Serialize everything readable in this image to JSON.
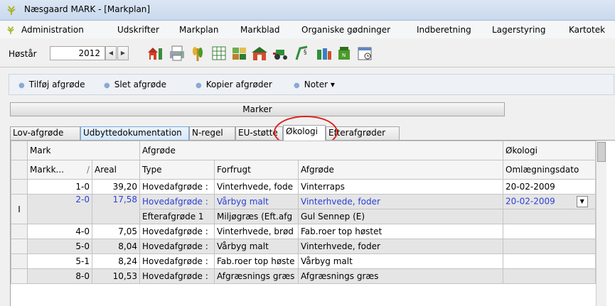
{
  "window": {
    "title": "Næsgaard MARK - [Markplan]"
  },
  "menu": [
    "Administration",
    "Udskrifter",
    "Markplan",
    "Markblad",
    "Organiske gødninger",
    "Indberetning",
    "Lagerstyring",
    "Kartotek"
  ],
  "toolbar": {
    "year_label": "Høstår",
    "year_value": "2012",
    "icons": [
      "farm-icon",
      "printer-icon",
      "crops-icon",
      "spreadsheet-icon",
      "fields-icon",
      "barn-icon",
      "tractor-icon",
      "law-icon",
      "bottles-icon",
      "fertilizer-icon",
      "calendar-icon"
    ]
  },
  "actions": [
    "Tilføj afgrøde",
    "Slet afgrøde",
    "Kopier afgrøder",
    "Noter"
  ],
  "marker_header": "Marker",
  "tabs": [
    "Lov-afgrøde",
    "Udbyttedokumentation",
    "N-regel",
    "EU-støtte",
    "Økologi",
    "Efterafgrøder"
  ],
  "grid": {
    "group_headers": {
      "mark": "Mark",
      "afgrode": "Afgrøde",
      "okologi": "Økologi"
    },
    "columns": [
      "Markk...",
      "Areal",
      "Type",
      "Forfrugt",
      "Afgrøde",
      "Omlægningsdato"
    ],
    "sort_indicator": "/",
    "row_marker": "I",
    "rows": [
      {
        "mark": "1-0",
        "areal": "39,20",
        "type": "Hovedafgrøde :",
        "forfrugt": "Vinterhvede, fode",
        "afgrode": "Vinterraps",
        "dato": "20-02-2009"
      },
      {
        "mark": "2-0",
        "areal": "17,58",
        "type": "Hovedafgrøde :",
        "forfrugt": "Vårbyg malt",
        "afgrode": "Vinterhvede, foder",
        "dato": "20-02-2009"
      },
      {
        "mark": "",
        "areal": "",
        "type": "Efterafgrøde 1",
        "forfrugt": "Miljøgræs (Eft.afg",
        "afgrode": "Gul Sennep (E)",
        "dato": ""
      },
      {
        "mark": "4-0",
        "areal": "7,05",
        "type": "Hovedafgrøde :",
        "forfrugt": "Vinterhvede, brød",
        "afgrode": "Fab.roer top høstet",
        "dato": ""
      },
      {
        "mark": "5-0",
        "areal": "8,04",
        "type": "Hovedafgrøde :",
        "forfrugt": "Vårbyg malt",
        "afgrode": "Vinterhvede, foder",
        "dato": ""
      },
      {
        "mark": "5-1",
        "areal": "8,24",
        "type": "Hovedafgrøde :",
        "forfrugt": "Fab.roer top høste",
        "afgrode": "Vårbyg malt",
        "dato": ""
      },
      {
        "mark": "8-0",
        "areal": "10,53",
        "type": "Hovedafgrøde :",
        "forfrugt": "Afgræsnings græs",
        "afgrode": "Afgræsnings græs",
        "dato": ""
      }
    ]
  },
  "colors": {
    "highlight_circle": "#e0201a",
    "selected_text": "#2b3fd6"
  }
}
